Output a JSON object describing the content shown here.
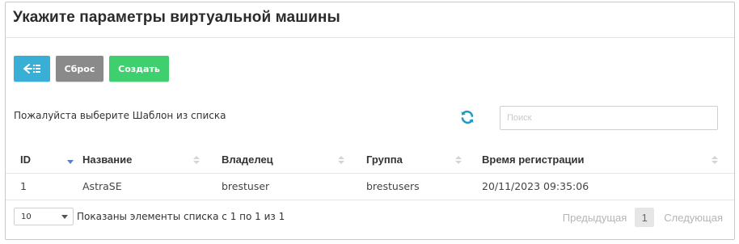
{
  "header": {
    "title": "Укажите параметры виртуальной машины"
  },
  "toolbar": {
    "back_icon": "arrow-left-list-icon",
    "reset_label": "Сброс",
    "create_label": "Создать",
    "colors": {
      "back": "#3aafd6",
      "reset": "#8a8a8a",
      "create": "#3fcf6e"
    }
  },
  "hint": "Пожалуйста выберите Шаблон из списка",
  "refresh_icon": "refresh-icon",
  "search": {
    "placeholder": "Поиск",
    "value": ""
  },
  "table": {
    "columns": [
      "ID",
      "Название",
      "Владелец",
      "Группа",
      "Время регистрации"
    ],
    "sort": {
      "active_column": "ID",
      "direction": "asc"
    },
    "rows": [
      {
        "id": "1",
        "name": "AstraSE",
        "owner": "brestuser",
        "group": "brestusers",
        "registered": "20/11/2023 09:35:06"
      }
    ]
  },
  "footer": {
    "page_size": "10",
    "info": "Показаны элементы списка с 1 по 1 из 1",
    "prev_label": "Предыдущая",
    "current_page": "1",
    "next_label": "Следующая"
  }
}
